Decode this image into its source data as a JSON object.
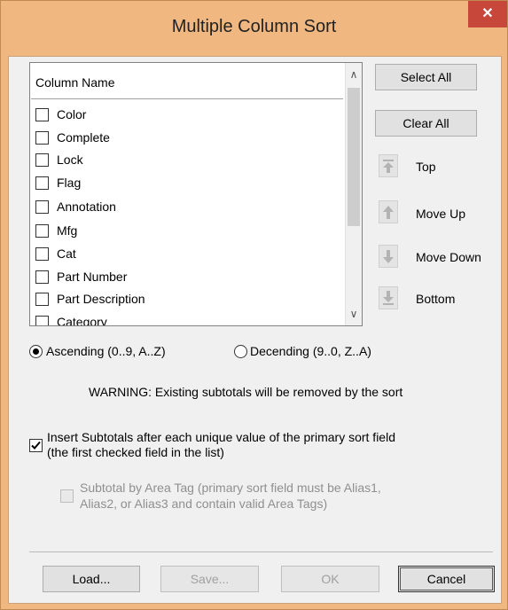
{
  "window": {
    "title": "Multiple Column Sort",
    "close_glyph": "✕"
  },
  "list": {
    "header": "Column Name",
    "items": [
      {
        "label": "Color",
        "checked": false
      },
      {
        "label": "Complete",
        "checked": false
      },
      {
        "label": "Lock",
        "checked": false
      },
      {
        "label": "Flag",
        "checked": false
      },
      {
        "label": "Annotation",
        "checked": false
      },
      {
        "label": "Mfg",
        "checked": false
      },
      {
        "label": "Cat",
        "checked": false
      },
      {
        "label": "Part Number",
        "checked": false
      },
      {
        "label": "Part Description",
        "checked": false
      },
      {
        "label": "Category",
        "checked": false
      }
    ],
    "scroll_up_glyph": "∧",
    "scroll_down_glyph": "∨"
  },
  "side_buttons": {
    "select_all": "Select All",
    "clear_all": "Clear All"
  },
  "move": {
    "top": "Top",
    "move_up": "Move Up",
    "move_down": "Move Down",
    "bottom": "Bottom"
  },
  "order": {
    "ascending": "Ascending (0..9, A..Z)",
    "descending": "Decending (9..0, Z..A)",
    "selected": "ascending"
  },
  "warning": "WARNING: Existing subtotals will be removed by the sort",
  "insert_subtotals": {
    "line1": "Insert Subtotals after each unique value of the primary sort field",
    "line2": "(the first checked field in the list)",
    "checked": true
  },
  "area_tag": {
    "line1": "Subtotal by Area Tag (primary sort field must be Alias1,",
    "line2": "Alias2, or Alias3 and contain valid Area Tags)",
    "checked": false,
    "enabled": false
  },
  "footer": {
    "load": "Load...",
    "save": "Save...",
    "ok": "OK",
    "cancel": "Cancel"
  }
}
